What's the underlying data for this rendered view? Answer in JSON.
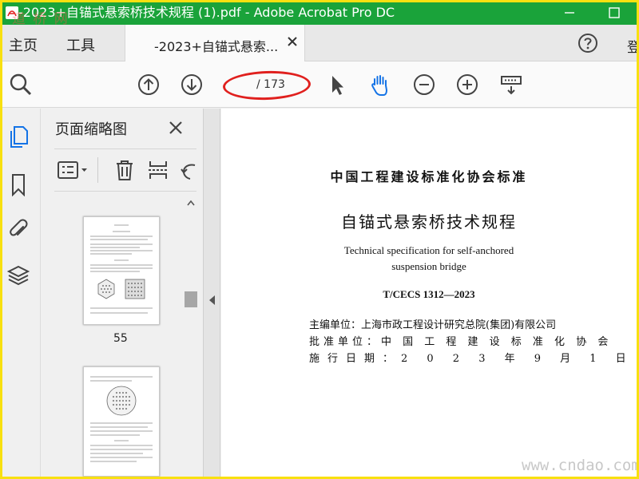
{
  "window": {
    "title": "-2023+自锚式悬索桥技术规程 (1).pdf - Adobe Acrobat Pro DC",
    "watermark": "道 桥 网",
    "app_icon": "acrobat-icon"
  },
  "menu": {
    "home": "主页",
    "tools": "工具",
    "sign_in": "登"
  },
  "tab": {
    "label": "-2023+自锚式悬索..."
  },
  "toolbar": {
    "page_input_value": "",
    "page_total": "/ 173"
  },
  "panel": {
    "title": "页面缩略图",
    "thumbnails": [
      {
        "page_number": "55"
      }
    ]
  },
  "document": {
    "organization": "中国工程建设标准化协会标准",
    "title_cn": "自锚式悬索桥技术规程",
    "title_en_line1": "Technical specification for self-anchored",
    "title_en_line2": "suspension bridge",
    "code": "T/CECS 1312—2023",
    "editor_unit": "主编单位：上海市政工程设计研究总院(集团)有限公司",
    "approval_unit": "批准单位：中 国 工 程 建 设 标 准 化 协 会",
    "effective_date": "施行日期：2 0 2 3 年 9 月 1 日"
  },
  "site_watermark": "www.cndao.com",
  "colors": {
    "titlebar": "#1aa33a",
    "accent": "#1473e6",
    "frame": "#f8e010",
    "highlight": "#e0201e"
  }
}
